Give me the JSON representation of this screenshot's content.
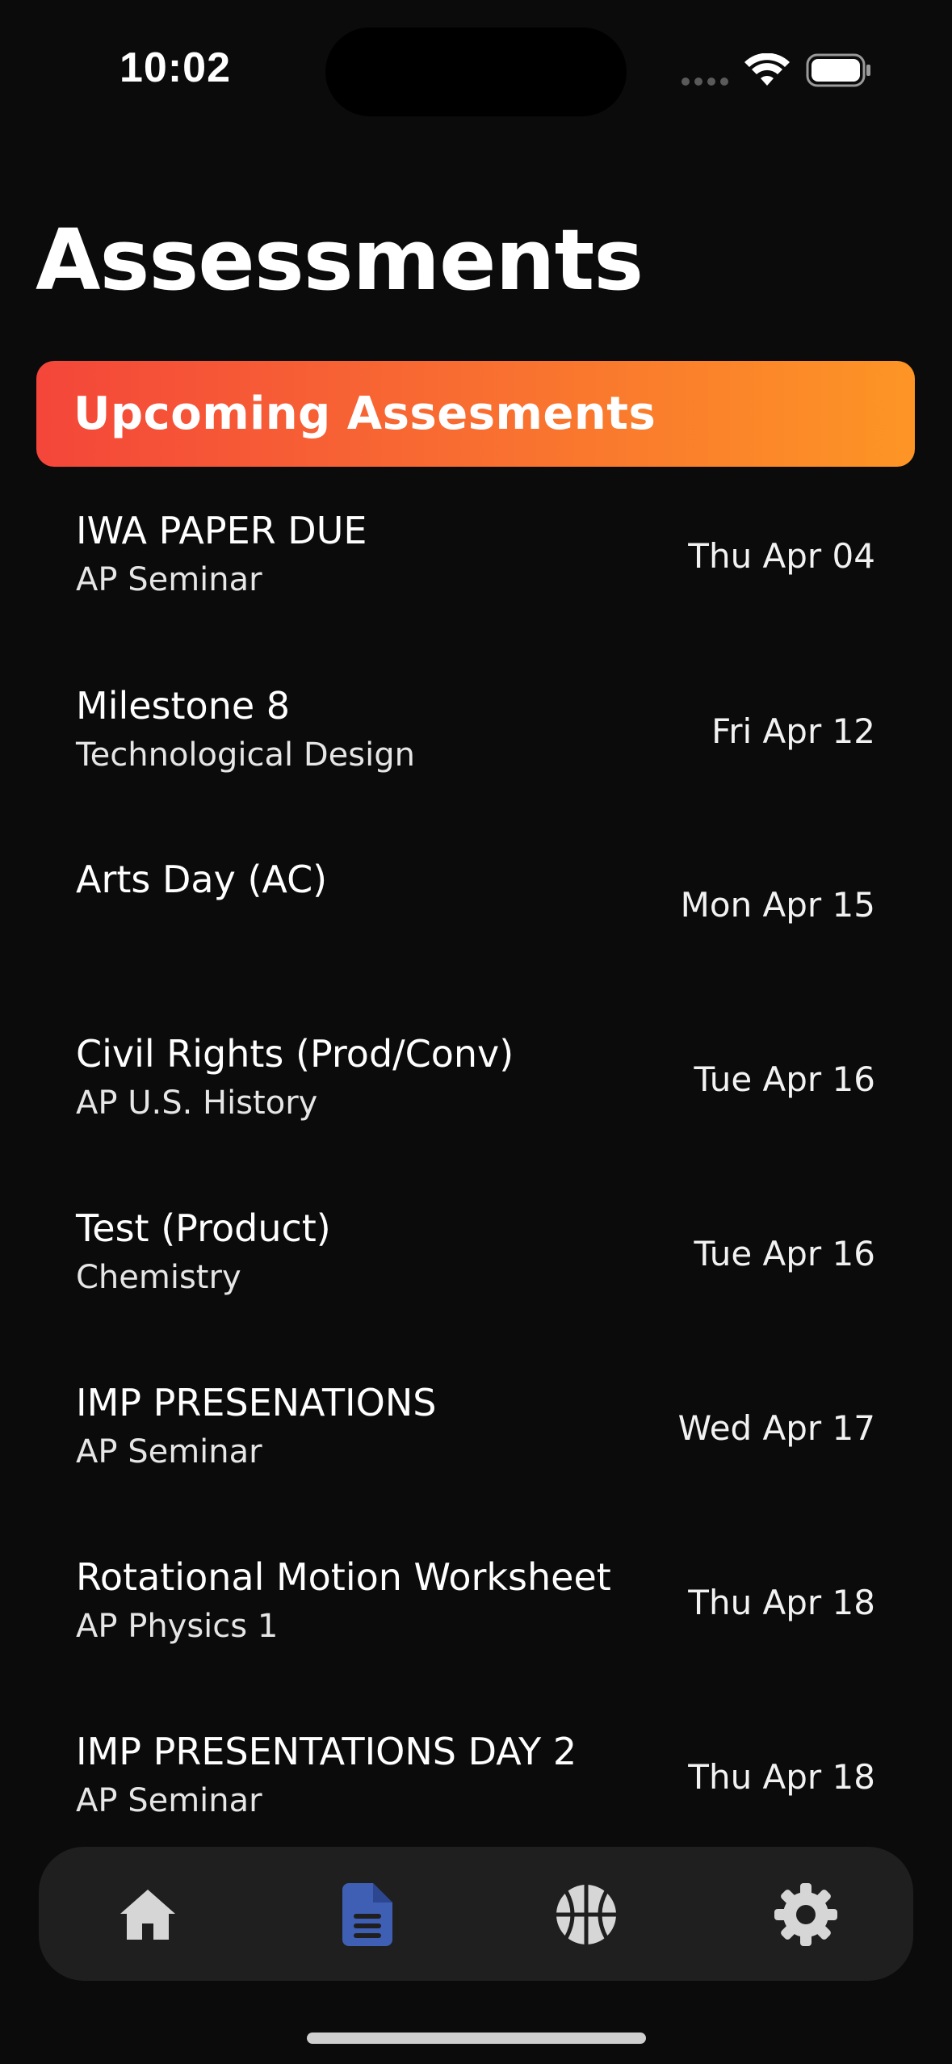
{
  "status_bar": {
    "time": "10:02"
  },
  "page": {
    "title": "Assessments"
  },
  "section": {
    "label": "Upcoming Assesments",
    "gradient_start": "#f4463a",
    "gradient_end": "#fd9525"
  },
  "assessments": [
    {
      "title": "IWA PAPER DUE",
      "subject": "AP Seminar",
      "date": "Thu Apr 04"
    },
    {
      "title": "Milestone 8",
      "subject": "Technological Design",
      "date": "Fri Apr 12"
    },
    {
      "title": "Arts Day (AC)",
      "subject": "",
      "date": "Mon Apr 15"
    },
    {
      "title": "Civil Rights (Prod/Conv)",
      "subject": "AP U.S. History",
      "date": "Tue Apr 16"
    },
    {
      "title": "Test (Product)",
      "subject": "Chemistry",
      "date": "Tue Apr 16"
    },
    {
      "title": "IMP PRESENATIONS",
      "subject": "AP Seminar",
      "date": "Wed Apr 17"
    },
    {
      "title": "Rotational Motion Worksheet",
      "subject": "AP Physics 1",
      "date": "Thu Apr 18"
    },
    {
      "title": "IMP PRESENTATIONS DAY 2",
      "subject": "AP Seminar",
      "date": "Thu Apr 18"
    }
  ],
  "tab_bar": {
    "tabs": [
      {
        "icon": "home-icon",
        "active": false
      },
      {
        "icon": "document-icon",
        "active": true
      },
      {
        "icon": "basketball-icon",
        "active": false
      },
      {
        "icon": "gear-icon",
        "active": false
      }
    ],
    "active_color": "#3f5fb5",
    "inactive_color": "#d6d6d6"
  }
}
